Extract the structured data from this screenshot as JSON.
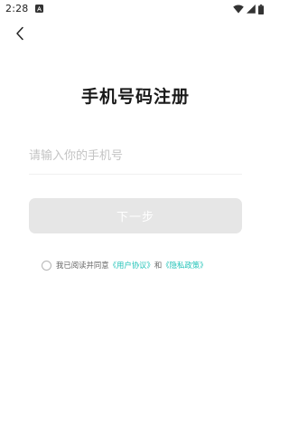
{
  "status_bar": {
    "time": "2:28"
  },
  "colors": {
    "link": "#22c3b8",
    "button_disabled": "#e6e6e6",
    "title": "#1a1a1a"
  },
  "icons": {
    "back": "chevron-left-icon",
    "notification": "app-notification-icon",
    "wifi": "wifi-icon",
    "signal": "signal-icon",
    "battery": "battery-icon"
  },
  "page": {
    "title": "手机号码注册"
  },
  "form": {
    "phone_placeholder": "请输入你的手机号",
    "phone_value": "",
    "next_label": "下一步"
  },
  "agreement": {
    "checked": false,
    "prefix": "我已阅读并同意",
    "user_agreement": "《用户协议》",
    "and": "和",
    "privacy_policy": "《隐私政策》"
  }
}
